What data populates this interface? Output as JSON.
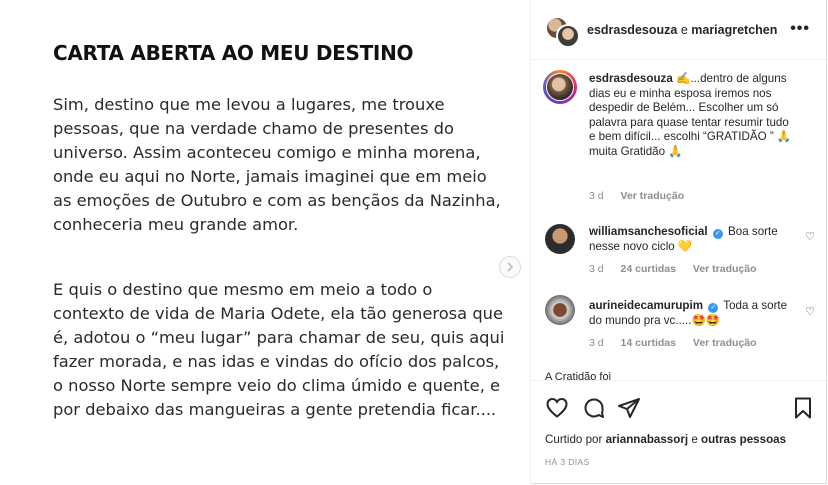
{
  "post": {
    "title": "CARTA ABERTA AO MEU DESTINO",
    "paragraph1": "Sim, destino que me levou a lugares, me trouxe pessoas, que na verdade chamo de presentes do universo. Assim aconteceu comigo e minha morena, onde eu aqui no Norte, jamais imaginei que em meio as emoções de Outubro e com as bençãos da Nazinha, conheceria meu grande amor.",
    "paragraph2": "E quis o destino que mesmo em meio a todo o contexto de vida de Maria Odete, ela tão generosa que é, adotou o “meu lugar” para chamar de seu, quis aqui fazer morada, e nas idas e vindas do ofício dos palcos, o nosso Norte sempre veio do clima úmido e quente, e por debaixo das mangueiras a gente pretendia ficar....",
    "next_icon": "chevron-right-icon"
  },
  "header": {
    "user1": "esdrasdesouza",
    "connector": "e",
    "user2": "mariagretchen",
    "more_icon": "more-horizontal-icon"
  },
  "caption": {
    "username": "esdrasdesouza",
    "text": "✍️...dentro de alguns dias eu e minha esposa iremos nos despedir de Belém... Escolher um só palavra para quase tentar resumir tudo e bem difícil... escolhi “GRATIDÃO ” 🙏 muita Gratidão 🙏",
    "age": "3 d",
    "translate": "Ver tradução"
  },
  "comments": [
    {
      "username": "williamsanchesoficial",
      "text": "Boa sorte nesse novo ciclo 💛",
      "age": "3 d",
      "likes": "24 curtidas",
      "translate": "Ver tradução"
    },
    {
      "username": "aurineidecamurupim",
      "text": "Toda a sorte do mundo pra vc.....🤩🤩",
      "age": "3 d",
      "likes": "14 curtidas",
      "translate": "Ver tradução"
    }
  ],
  "partial_comment": "                A Cratidão foi",
  "liked_by": {
    "prefix": "Curtido por",
    "user": "ariannabassorj",
    "connector": "e",
    "others": "outras pessoas"
  },
  "date": "HÁ 3 DIAS",
  "icons": {
    "like": "heart-icon",
    "comment": "comment-icon",
    "share": "share-icon",
    "save": "bookmark-icon"
  }
}
